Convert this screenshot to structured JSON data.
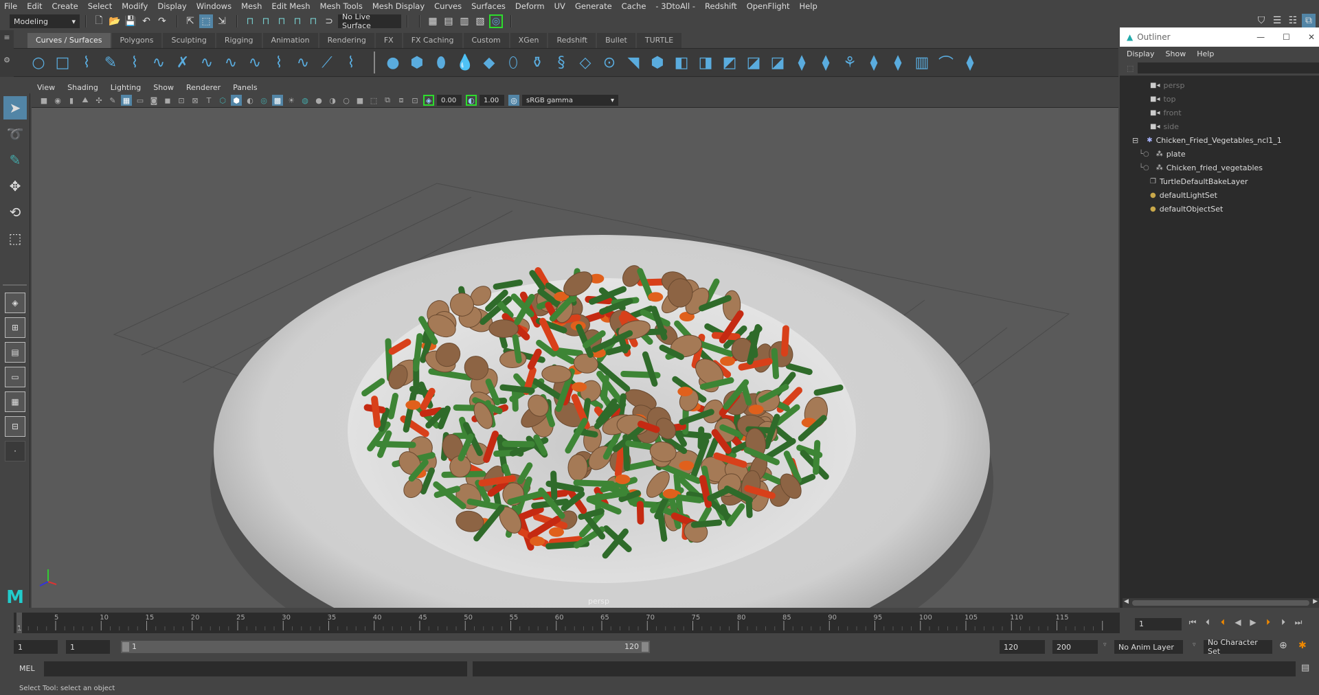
{
  "menubar": [
    "File",
    "Edit",
    "Create",
    "Select",
    "Modify",
    "Display",
    "Windows",
    "Mesh",
    "Edit Mesh",
    "Mesh Tools",
    "Mesh Display",
    "Curves",
    "Surfaces",
    "Deform",
    "UV",
    "Generate",
    "Cache",
    "- 3DtoAll -",
    "Redshift",
    "OpenFlight",
    "Help"
  ],
  "statusline": {
    "menuset": "Modeling",
    "live_surface": "No Live Surface",
    "file_icons": [
      "new-scene-icon",
      "open-scene-icon",
      "save-scene-icon",
      "undo-icon",
      "redo-icon"
    ],
    "select_icons": [
      "select-by-hierarchy-icon",
      "select-by-object-icon",
      "select-by-component-icon"
    ],
    "snap_icons": [
      "snap-grid-icon",
      "snap-curve-icon",
      "snap-point-icon",
      "snap-view-plane-icon",
      "snap-live-icon",
      "make-live-icon"
    ],
    "render_icons": [
      "render-frame-icon",
      "render-sequence-icon",
      "ipr-render-icon",
      "render-settings-icon",
      "hypershade-icon"
    ]
  },
  "shelf": {
    "tabs": [
      "Curves / Surfaces",
      "Polygons",
      "Sculpting",
      "Rigging",
      "Animation",
      "Rendering",
      "FX",
      "FX Caching",
      "Custom",
      "XGen",
      "Redshift",
      "Bullet",
      "TURTLE"
    ],
    "active_tab": "Curves / Surfaces",
    "curve_tools": [
      "circle-icon",
      "square-icon",
      "cv-curve-icon",
      "pencil-curve-icon",
      "ep-curve-icon",
      "arc-icon",
      "bezier-icon",
      "rebuild-curve-icon",
      "attach-curve-icon",
      "offset-curve-icon",
      "curve-fillet-icon",
      "insert-knot-icon",
      "cut-curve-icon",
      "extend-curve-icon"
    ],
    "surface_tools": [
      "nurbs-sphere-icon",
      "nurbs-cube-icon",
      "nurbs-cylinder-icon",
      "nurbs-cone-icon",
      "nurbs-plane-icon",
      "nurbs-torus-icon",
      "revolve-icon",
      "loft-icon",
      "planar-icon",
      "extrude-icon",
      "birail-icon",
      "boundary-icon",
      "trim-icon",
      "project-curve-icon",
      "intersect-icon",
      "untrim-icon",
      "attach-surface-icon",
      "detach-surface-icon",
      "fillet-icon",
      "stitch-icon",
      "sculpt-icon",
      "insert-isoparm-icon",
      "rebuild-surface-icon",
      "sculpt-surface-icon",
      "reverse-direction-icon"
    ]
  },
  "viewport": {
    "menus": [
      "View",
      "Shading",
      "Lighting",
      "Show",
      "Renderer",
      "Panels"
    ],
    "exposure": "0.00",
    "gamma": "1.00",
    "color_space": "sRGB gamma",
    "camera_label": "persp"
  },
  "outliner": {
    "title": "Outliner",
    "menus": [
      "Display",
      "Show",
      "Help"
    ],
    "items": [
      {
        "label": "persp",
        "type": "camera",
        "dim": true,
        "indent": 0
      },
      {
        "label": "top",
        "type": "camera",
        "dim": true,
        "indent": 0
      },
      {
        "label": "front",
        "type": "camera",
        "dim": true,
        "indent": 0
      },
      {
        "label": "side",
        "type": "camera",
        "dim": true,
        "indent": 0
      },
      {
        "label": "Chicken_Fried_Vegetables_ncl1_1",
        "type": "group",
        "dim": false,
        "indent": 0,
        "expanded": true
      },
      {
        "label": "plate",
        "type": "mesh",
        "dim": false,
        "indent": 1
      },
      {
        "label": "Chicken_fried_vegetables",
        "type": "mesh",
        "dim": false,
        "indent": 1
      },
      {
        "label": "TurtleDefaultBakeLayer",
        "type": "bakelayer",
        "dim": false,
        "indent": 0
      },
      {
        "label": "defaultLightSet",
        "type": "set",
        "dim": false,
        "indent": 0
      },
      {
        "label": "defaultObjectSet",
        "type": "set",
        "dim": false,
        "indent": 0
      }
    ]
  },
  "timeline": {
    "ticks": [
      "5",
      "10",
      "15",
      "20",
      "25",
      "30",
      "35",
      "40",
      "45",
      "50",
      "55",
      "60",
      "65",
      "70",
      "75",
      "80",
      "85",
      "90",
      "95",
      "100",
      "105",
      "110",
      "115"
    ],
    "current_frame": "1",
    "current_frame_field": "1"
  },
  "range": {
    "start": "1",
    "playback_start": "1",
    "slider_start": "1",
    "slider_end": "120",
    "playback_end": "120",
    "end": "200",
    "anim_layer": "No Anim Layer",
    "character_set": "No Character Set"
  },
  "cmdline": {
    "label": "MEL"
  },
  "helpline": "Select Tool: select an object"
}
